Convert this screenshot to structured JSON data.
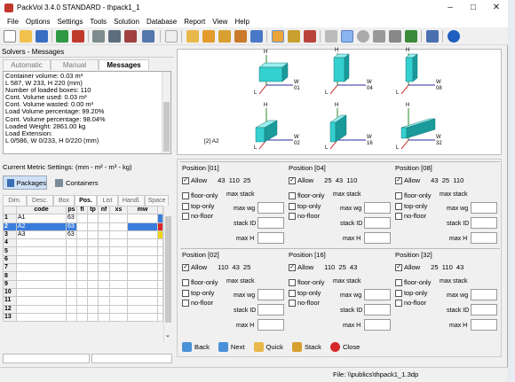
{
  "window": {
    "title": "PackVol 3.4.0 STANDARD - thpack1_1"
  },
  "menu": [
    "File",
    "Options",
    "Settings",
    "Tools",
    "Solution",
    "Database",
    "Report",
    "View",
    "Help"
  ],
  "solvers": {
    "header": "Solvers - Messages",
    "tabs": [
      "Automatic",
      "Manual",
      "Messages"
    ],
    "messages": [
      "Container volume: 0.03 m³",
      "L 587, W 233, H 220 (mm)",
      "Number of loaded boxes: 110",
      "Cont. Volume used: 0.03 m³",
      "Cont. Volume wasted: 0.00 m³",
      "Load Volume percentage: 99.20%",
      "Cont. Volume percentage: 98.04%",
      "Loaded Weight: 2861.00 kg",
      "Load Extension:",
      "L 0/586, W 0/233, H 0/220 (mm)"
    ]
  },
  "metric": {
    "label": "Current Metric Settings: (mm - m² - m³ - kg)",
    "tabs": [
      "Packages",
      "Containers"
    ]
  },
  "grid": {
    "tabs": [
      "Dim.",
      "Desc.",
      "Box",
      "Pos.",
      "List",
      "Handl.",
      "Space"
    ],
    "columns": [
      "",
      "code",
      "ps",
      "fl",
      "tp",
      "nf",
      "xs",
      "mw"
    ],
    "rows": [
      {
        "n": "1",
        "code": "A1",
        "ps": "63"
      },
      {
        "n": "2",
        "code": "A2",
        "ps": "63"
      },
      {
        "n": "3",
        "code": "A3",
        "ps": "63"
      },
      {
        "n": "4",
        "code": "",
        "ps": ""
      },
      {
        "n": "5",
        "code": "",
        "ps": ""
      },
      {
        "n": "6",
        "code": "",
        "ps": ""
      },
      {
        "n": "7",
        "code": "",
        "ps": ""
      },
      {
        "n": "8",
        "code": "",
        "ps": ""
      },
      {
        "n": "9",
        "code": "",
        "ps": ""
      },
      {
        "n": "10",
        "code": "",
        "ps": ""
      },
      {
        "n": "11",
        "code": "",
        "ps": ""
      },
      {
        "n": "12",
        "code": "",
        "ps": ""
      },
      {
        "n": "13",
        "code": "",
        "ps": ""
      }
    ]
  },
  "orientations": {
    "selected_label": "[2] A2",
    "axes": {
      "h": "H",
      "w": "W",
      "l": "L"
    },
    "items": [
      "01",
      "04",
      "08",
      "02",
      "16",
      "32"
    ]
  },
  "positions": [
    {
      "title": "Position [01]",
      "dims": "43  110  25"
    },
    {
      "title": "Position [04]",
      "dims": "25  43  110"
    },
    {
      "title": "Position [08]",
      "dims": "43  25  110"
    },
    {
      "title": "Position [02]",
      "dims": "110  43  25"
    },
    {
      "title": "Position [16]",
      "dims": "110  25  43"
    },
    {
      "title": "Position [32]",
      "dims": "25  110  43"
    }
  ],
  "position_labels": {
    "allow": "Allow",
    "floor_only": "floor-only",
    "top_only": "top-only",
    "no_floor": "no-floor",
    "max_stack": "max stack",
    "max_wg": "max wg",
    "stack_id": "stack ID",
    "max_h": "max H"
  },
  "actions": [
    "Back",
    "Next",
    "Quick",
    "Stack",
    "Close"
  ],
  "status": {
    "file": "File: \\\\publics\\thpack1_1.3dp"
  },
  "colors": {
    "box": "#35d0d0",
    "box_top": "#9aeeee",
    "box_side": "#1a9a9a",
    "selection": "#3b7ddd",
    "row_marker_blue": "#3b7ddd",
    "row_marker_red": "#d62828",
    "row_marker_yellow": "#f2d21b"
  }
}
